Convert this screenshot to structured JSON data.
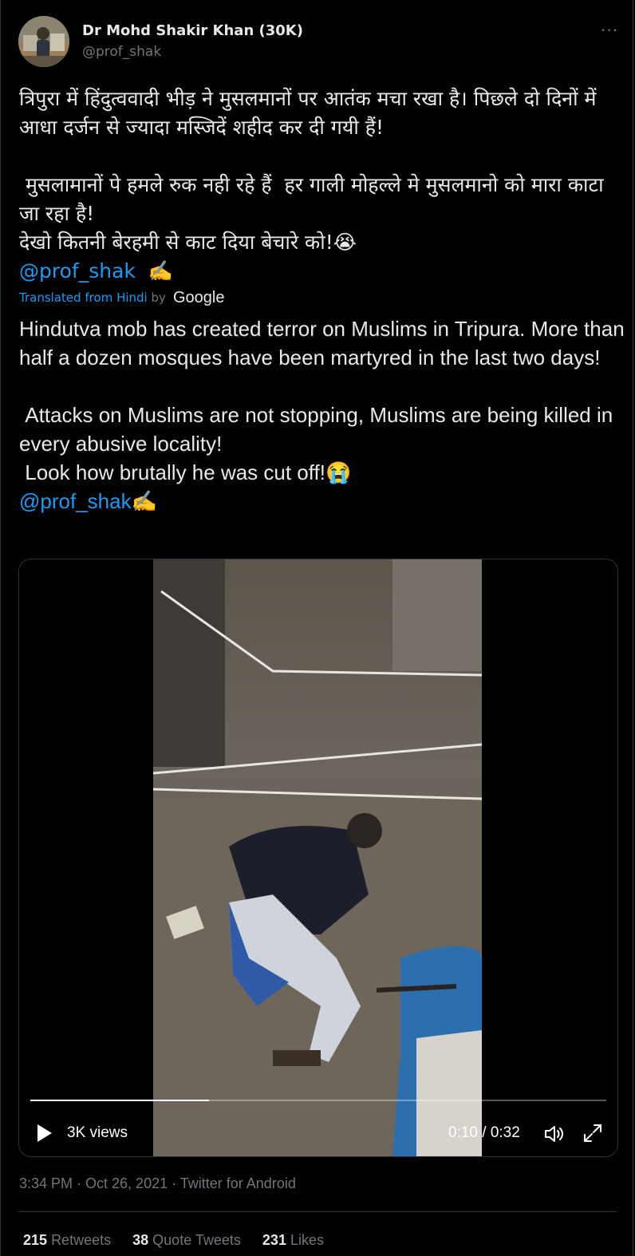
{
  "tweet": {
    "author_name": "Dr Mohd Shakir Khan (30K)",
    "author_handle": "@prof_shak",
    "more_icon": "more-horizontal-icon",
    "hindi_text": "त्रिपुरा में हिंदुत्ववादी भीड़ ने मुसलमानों पर आतंक मचा रखा है। पिछले दो दिनों में आधा दर्जन से ज्यादा मस्जिदें शहीद कर दी गयी हैं!\n\n मुसलामानों पे हमले रुक नही रहे हैं  हर गाली मोहल्ले मे मुसलमानो को मारा काटा जा रहा है!\nदेखो कितनी बेरहमी से काट दिया बेचारे को!😭",
    "hindi_mention": "@prof_shak  ✍️",
    "translated_prefix": "Translated from Hindi ",
    "translated_by": "by",
    "google_label": "Google",
    "english_text": "Hindutva mob has created terror on Muslims in Tripura. More than half a dozen mosques have been martyred in the last two days!\n\n Attacks on Muslims are not stopping, Muslims are being killed in every abusive locality!\n Look how brutally he was cut off!😭",
    "english_mention": "@prof_shak✍️"
  },
  "video": {
    "views": "3K views",
    "time": "0:10 / 0:32",
    "progress": 0.31,
    "play_icon": "play-icon",
    "volume_icon": "volume-icon",
    "fullscreen_icon": "fullscreen-icon"
  },
  "meta": {
    "timestamp": "3:34 PM · Oct 26, 2021 · Twitter for Android"
  },
  "stats": {
    "retweets_count": "215",
    "retweets_label": "Retweets",
    "quotes_count": "38",
    "quotes_label": "Quote Tweets",
    "likes_count": "231",
    "likes_label": "Likes"
  },
  "colors": {
    "background": "#000000",
    "text": "#e7e9ea",
    "secondary": "#71767b",
    "link": "#1d9bf0",
    "border": "#2f3336"
  }
}
